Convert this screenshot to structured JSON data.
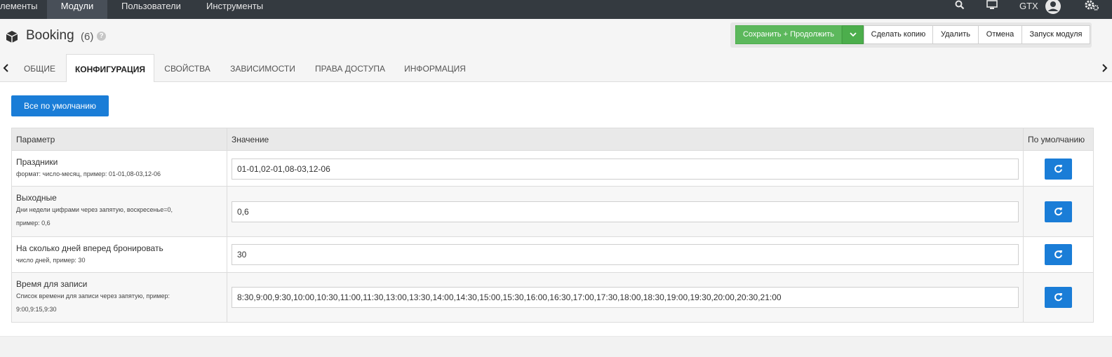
{
  "topnav": {
    "items": [
      {
        "label": "лементы"
      },
      {
        "label": "Модули"
      },
      {
        "label": "Пользователи"
      },
      {
        "label": "Инструменты"
      }
    ],
    "user": "GTX"
  },
  "header": {
    "title": "Booking",
    "count": "(6)"
  },
  "toolbar": {
    "save_continue": "Сохранить + Продолжить",
    "copy": "Сделать копию",
    "delete": "Удалить",
    "cancel": "Отмена",
    "run": "Запуск модуля"
  },
  "tabs": [
    {
      "label": "ОБЩИЕ"
    },
    {
      "label": "КОНФИГУРАЦИЯ"
    },
    {
      "label": "СВОЙСТВА"
    },
    {
      "label": "ЗАВИСИМОСТИ"
    },
    {
      "label": "ПРАВА ДОСТУПА"
    },
    {
      "label": "ИНФОРМАЦИЯ"
    }
  ],
  "main": {
    "defaults_button": "Все по умолчанию",
    "columns": {
      "param": "Параметр",
      "value": "Значение",
      "default": "По умолчанию"
    },
    "rows": [
      {
        "name": "Праздники",
        "hint": "формат: число-месяц, пример: 01-01,08-03,12-06",
        "hint2": "",
        "value": "01-01,02-01,08-03,12-06"
      },
      {
        "name": "Выходные",
        "hint": "Дни недели цифрами через запятую, воскресенье=0,",
        "hint2": "пример: 0,6",
        "value": "0,6"
      },
      {
        "name": "На сколько дней вперед бронировать",
        "hint": "число дней, пример: 30",
        "hint2": "",
        "value": "30"
      },
      {
        "name": "Время для записи",
        "hint": "Список времени для записи через запятую, пример:",
        "hint2": "9:00,9:15,9:30",
        "value": "8:30,9:00,9:30,10:00,10:30,11:00,11:30,13:00,13:30,14:00,14:30,15:00,15:30,16:00,16:30,17:00,17:30,18:00,18:30,19:00,19:30,20:00,20:30,21:00"
      }
    ]
  },
  "colors": {
    "nav_bg": "#343a40",
    "primary": "#1a7dd7",
    "success": "#5cb85c"
  }
}
